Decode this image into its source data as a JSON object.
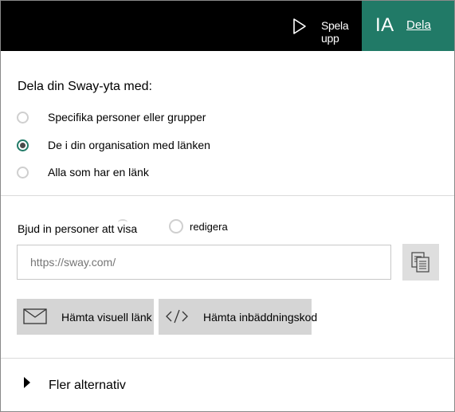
{
  "header": {
    "play_label": "Spela upp",
    "initials": "IA",
    "share_label": "Dela"
  },
  "share": {
    "title": "Dela din Sway-yta med:",
    "options": [
      {
        "label": "Specifika personer eller grupper",
        "selected": false
      },
      {
        "label": "De i din organisation med länken",
        "selected": true
      },
      {
        "label": "Alla som har en länk",
        "selected": false
      }
    ]
  },
  "invite": {
    "label": "Bjud in personer att visa",
    "edit_label": "redigera",
    "link_placeholder": "https://sway.com/"
  },
  "actions": {
    "visual_link_label": "Hämta visuell länk",
    "embed_code_label": "Hämta inbäddningskod"
  },
  "more": {
    "label": "Fler alternativ"
  },
  "colors": {
    "accent": "#217a67",
    "topbar": "#000000"
  }
}
